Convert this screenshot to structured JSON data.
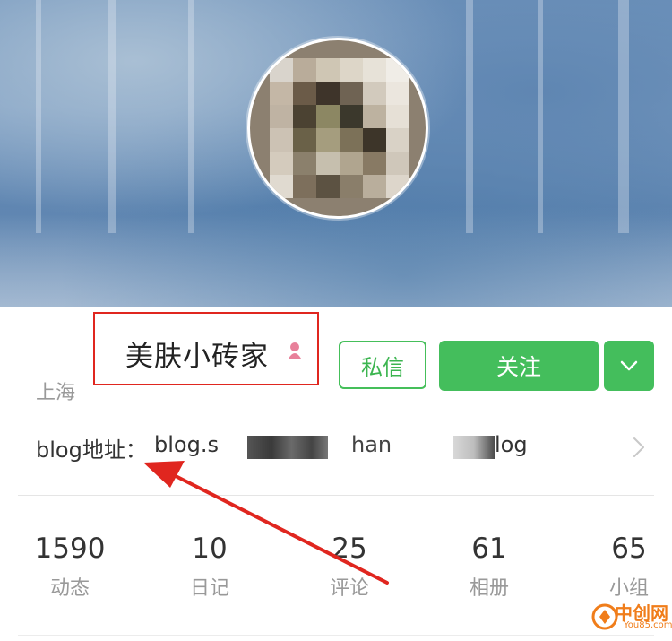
{
  "profile": {
    "name": "美肤小砖家",
    "location": "上海",
    "gender_icon": "female-icon"
  },
  "actions": {
    "message_label": "私信",
    "follow_label": "关注",
    "more_icon": "chevron-down-icon"
  },
  "blog": {
    "label": "blog地址：",
    "url_part_1": "blog.s",
    "url_part_2": "han",
    "url_part_3": "log"
  },
  "stats": [
    {
      "value": "1590",
      "label": "动态"
    },
    {
      "value": "10",
      "label": "日记"
    },
    {
      "value": "25",
      "label": "评论"
    },
    {
      "value": "61",
      "label": "相册"
    },
    {
      "value": "65",
      "label": "小组"
    }
  ],
  "watermark": {
    "text": "中创网",
    "sub": "You85.com"
  },
  "colors": {
    "accent_green": "#44be5c",
    "annotation_red": "#e0261f"
  }
}
